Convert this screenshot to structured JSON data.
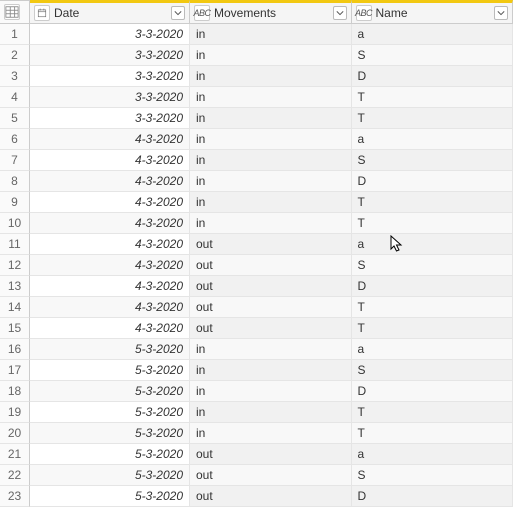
{
  "columns": {
    "date": {
      "label": "Date"
    },
    "movements": {
      "label": "Movements"
    },
    "name": {
      "label": "Name"
    }
  },
  "rows": [
    {
      "n": "1",
      "date": "3-3-2020",
      "movements": "in",
      "name": "a"
    },
    {
      "n": "2",
      "date": "3-3-2020",
      "movements": "in",
      "name": "S"
    },
    {
      "n": "3",
      "date": "3-3-2020",
      "movements": "in",
      "name": "D"
    },
    {
      "n": "4",
      "date": "3-3-2020",
      "movements": "in",
      "name": "T"
    },
    {
      "n": "5",
      "date": "3-3-2020",
      "movements": "in",
      "name": "T"
    },
    {
      "n": "6",
      "date": "4-3-2020",
      "movements": "in",
      "name": "a"
    },
    {
      "n": "7",
      "date": "4-3-2020",
      "movements": "in",
      "name": "S"
    },
    {
      "n": "8",
      "date": "4-3-2020",
      "movements": "in",
      "name": "D"
    },
    {
      "n": "9",
      "date": "4-3-2020",
      "movements": "in",
      "name": "T"
    },
    {
      "n": "10",
      "date": "4-3-2020",
      "movements": "in",
      "name": "T"
    },
    {
      "n": "11",
      "date": "4-3-2020",
      "movements": "out",
      "name": "a"
    },
    {
      "n": "12",
      "date": "4-3-2020",
      "movements": "out",
      "name": "S"
    },
    {
      "n": "13",
      "date": "4-3-2020",
      "movements": "out",
      "name": "D"
    },
    {
      "n": "14",
      "date": "4-3-2020",
      "movements": "out",
      "name": "T"
    },
    {
      "n": "15",
      "date": "4-3-2020",
      "movements": "out",
      "name": "T"
    },
    {
      "n": "16",
      "date": "5-3-2020",
      "movements": "in",
      "name": "a"
    },
    {
      "n": "17",
      "date": "5-3-2020",
      "movements": "in",
      "name": "S"
    },
    {
      "n": "18",
      "date": "5-3-2020",
      "movements": "in",
      "name": "D"
    },
    {
      "n": "19",
      "date": "5-3-2020",
      "movements": "in",
      "name": "T"
    },
    {
      "n": "20",
      "date": "5-3-2020",
      "movements": "in",
      "name": "T"
    },
    {
      "n": "21",
      "date": "5-3-2020",
      "movements": "out",
      "name": "a"
    },
    {
      "n": "22",
      "date": "5-3-2020",
      "movements": "out",
      "name": "S"
    },
    {
      "n": "23",
      "date": "5-3-2020",
      "movements": "out",
      "name": "D"
    }
  ],
  "icons": {
    "abc_label": "ABC"
  }
}
